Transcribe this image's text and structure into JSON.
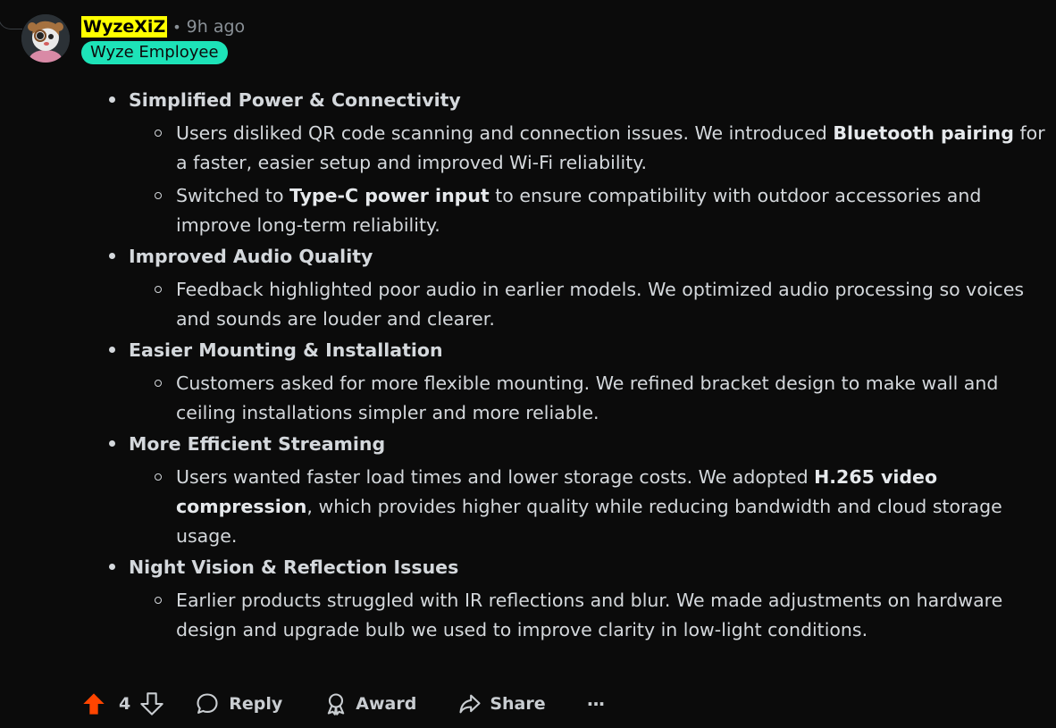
{
  "comment": {
    "username": "WyzeXiZ",
    "separator": "•",
    "time": "9h ago",
    "flair": "Wyze Employee"
  },
  "sections": [
    {
      "title": "Simplified Power & Connectivity",
      "items": [
        [
          "Users disliked QR code scanning and connection issues. We introduced ",
          {
            "b": "Bluetooth pairing"
          },
          " for a faster, easier setup and improved Wi-Fi reliability."
        ],
        [
          "Switched to ",
          {
            "b": "Type-C power input"
          },
          " to ensure compatibility with outdoor accessories and improve long-term reliability."
        ]
      ]
    },
    {
      "title": "Improved Audio Quality",
      "items": [
        [
          "Feedback highlighted poor audio in earlier models. We optimized audio processing so voices and sounds are louder and clearer."
        ]
      ]
    },
    {
      "title": "Easier Mounting & Installation",
      "items": [
        [
          "Customers asked for more flexible mounting. We refined bracket design to make wall and ceiling installations simpler and more reliable."
        ]
      ]
    },
    {
      "title": "More Efficient Streaming",
      "items": [
        [
          "Users wanted faster load times and lower storage costs. We adopted ",
          {
            "b": "H.265 video compression"
          },
          ", which provides higher quality while reducing bandwidth and cloud storage usage."
        ]
      ]
    },
    {
      "title": "Night Vision & Reflection Issues",
      "items": [
        [
          "Earlier products struggled with IR reflections and blur. We made adjustments on hardware design and upgrade bulb we used to improve clarity in low-light conditions."
        ]
      ]
    }
  ],
  "actions": {
    "upvote_count": "4",
    "reply_label": "Reply",
    "award_label": "Award",
    "share_label": "Share",
    "more_label": "···"
  },
  "colors": {
    "background": "#0b0b0b",
    "username_highlight": "#ffff00",
    "flair_bg": "#1de3b8",
    "upvote_active": "#ff4500"
  },
  "icons": [
    "avatar",
    "upvote-icon",
    "downvote-icon",
    "reply-icon",
    "award-icon",
    "share-icon",
    "more-icon"
  ]
}
